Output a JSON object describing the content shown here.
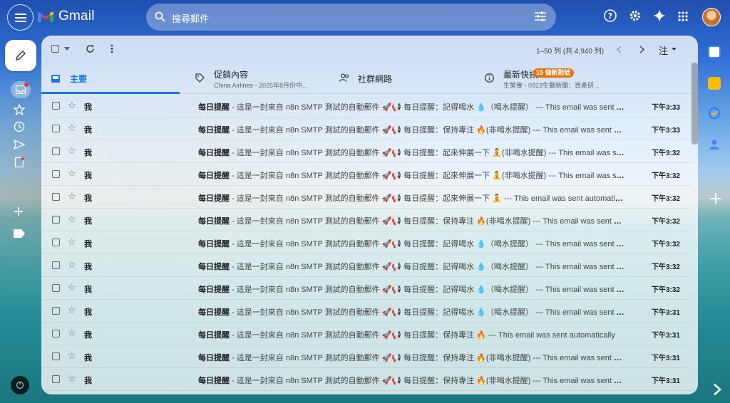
{
  "header": {
    "logo_text": "Gmail",
    "search_placeholder": "搜尋郵件"
  },
  "toolbar": {
    "pager": "1–50 列 (共 4,940 列)",
    "input_tool": "注"
  },
  "tabs": [
    {
      "label": "主要",
      "sub": "",
      "badge": ""
    },
    {
      "label": "促銷內容",
      "sub": "China Airlines - 2025年8月份中...",
      "badge": ""
    },
    {
      "label": "社群網路",
      "sub": "",
      "badge": ""
    },
    {
      "label": "最新快訊",
      "sub": "生策會 - 0923生醫新聞：資產研...",
      "badge": "15 個新對話"
    }
  ],
  "emails": [
    {
      "sender": "我",
      "subject": "每日提醒",
      "snippet": " - 這是一封來自 n8n SMTP 測試的自動郵件 🚀📢 每日提醒：記得喝水 💧（喝水提醒） --- This email was sent automatically",
      "time": "下午3:33"
    },
    {
      "sender": "我",
      "subject": "每日提醒",
      "snippet": " - 這是一封來自 n8n SMTP 測試的自動郵件 🚀📢 每日提醒：保持專注 🔥(非喝水提醒) --- This email was sent automatically",
      "time": "下午3:33"
    },
    {
      "sender": "我",
      "subject": "每日提醒",
      "snippet": " - 這是一封來自 n8n SMTP 測試的自動郵件 🚀📢 每日提醒：起來伸展一下 🧘(非喝水提醒) --- This email was sent automatically",
      "time": "下午3:32"
    },
    {
      "sender": "我",
      "subject": "每日提醒",
      "snippet": " - 這是一封來自 n8n SMTP 測試的自動郵件 🚀📢 每日提醒：起來伸展一下 🧘(非喝水提醒) --- This email was sent automatically",
      "time": "下午3:32"
    },
    {
      "sender": "我",
      "subject": "每日提醒",
      "snippet": " - 這是一封來自 n8n SMTP 測試的自動郵件 🚀📢 每日提醒：起來伸展一下 🧘 --- This email was sent automatically",
      "time": "下午3:32"
    },
    {
      "sender": "我",
      "subject": "每日提醒",
      "snippet": " - 這是一封來自 n8n SMTP 測試的自動郵件 🚀📢 每日提醒：保持專注 🔥(非喝水提醒) --- This email was sent automatically",
      "time": "下午3:32"
    },
    {
      "sender": "我",
      "subject": "每日提醒",
      "snippet": " - 這是一封來自 n8n SMTP 測試的自動郵件 🚀📢 每日提醒：記得喝水 💧（喝水提醒） --- This email was sent automatically",
      "time": "下午3:32"
    },
    {
      "sender": "我",
      "subject": "每日提醒",
      "snippet": " - 這是一封來自 n8n SMTP 測試的自動郵件 🚀📢 每日提醒：記得喝水 💧（喝水提醒） --- This email was sent automatically",
      "time": "下午3:32"
    },
    {
      "sender": "我",
      "subject": "每日提醒",
      "snippet": " - 這是一封來自 n8n SMTP 測試的自動郵件 🚀📢 每日提醒：記得喝水 💧（喝水提醒） --- This email was sent automatically",
      "time": "下午3:32"
    },
    {
      "sender": "我",
      "subject": "每日提醒",
      "snippet": " - 這是一封來自 n8n SMTP 測試的自動郵件 🚀📢 每日提醒：記得喝水 💧（喝水提醒） --- This email was sent automatically",
      "time": "下午3:31"
    },
    {
      "sender": "我",
      "subject": "每日提醒",
      "snippet": " - 這是一封來自 n8n SMTP 測試的自動郵件 🚀📢 每日提醒：保持專注 🔥 --- This email was sent automatically",
      "time": "下午3:31"
    },
    {
      "sender": "我",
      "subject": "每日提醒",
      "snippet": " - 這是一封來自 n8n SMTP 測試的自動郵件 🚀📢 每日提醒：保持專注 🔥(非喝水提醒) --- This email was sent automatically",
      "time": "下午3:31"
    },
    {
      "sender": "我",
      "subject": "每日提醒",
      "snippet": " - 這是一封來自 n8n SMTP 測試的自動郵件 🚀📢 每日提醒：保持專注 🔥(非喝水提醒) --- This email was sent automatically",
      "time": "下午3:31"
    }
  ],
  "colors": {
    "accent": "#1a73e8",
    "badge": "#e8710a",
    "unread_dot": "#e53935"
  }
}
